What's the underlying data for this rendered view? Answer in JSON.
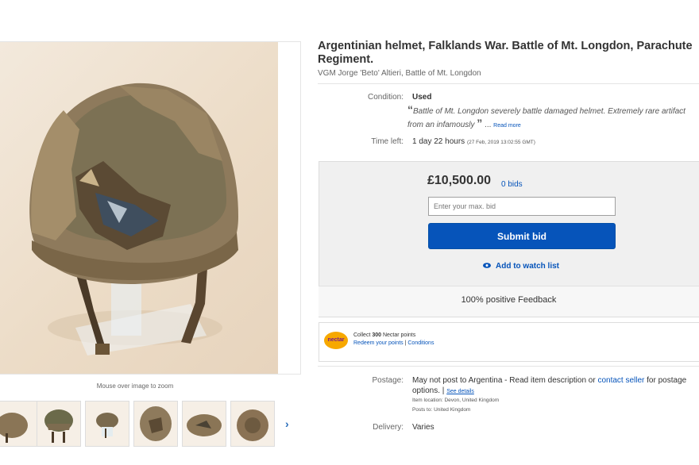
{
  "listing": {
    "title_line1": "Argentinian helmet, Falklands War. Battle of Mt. Longdon, Parachute",
    "title_line2": "Regiment.",
    "subtitle": "VGM Jorge 'Beto' Altieri, Battle of Mt. Longdon"
  },
  "image": {
    "zoom_hint": "Mouse over image to zoom",
    "thumbnail_count": 6
  },
  "details": {
    "condition_label": "Condition:",
    "condition_value": "Used",
    "quote_open": "“",
    "quote_line1": "Battle of Mt. Longdon severely battle damaged helmet. Extremely rare artifact",
    "quote_line2": "from an infamously",
    "quote_close": "”",
    "quote_ellipsis": "...",
    "read_more": "Read more",
    "time_left_label": "Time left:",
    "time_left_value": "1 day 22 hours",
    "time_left_date": "(27 Feb, 2019   13:02:55 GMT)"
  },
  "bid": {
    "price": "£10,500.00",
    "bids": "0 bids",
    "max_bid_placeholder": "Enter your max. bid",
    "submit_label": "Submit bid",
    "watch_label": "Add to watch list",
    "feedback": "100% positive Feedback"
  },
  "nectar": {
    "logo_text": "nectar",
    "collect_prefix": "Collect ",
    "collect_points": "300",
    "collect_suffix": " Nectar points",
    "redeem_label": "Redeem your points",
    "separator": " | ",
    "conditions_label": "Conditions"
  },
  "postage": {
    "label": "Postage:",
    "text_prefix": "May not post to Argentina - Read item description or ",
    "contact_link": "contact seller",
    "text_suffix": " for postage",
    "line2": "options. | ",
    "see_details": "See details",
    "item_location": "Item location:  Devon, United Kingdom",
    "posts_to": "Posts to:  United Kingdom"
  },
  "delivery": {
    "label": "Delivery:",
    "value": "Varies"
  },
  "colors": {
    "link": "#0654ba",
    "button": "#0654ba",
    "nectar": "#f7a800"
  }
}
